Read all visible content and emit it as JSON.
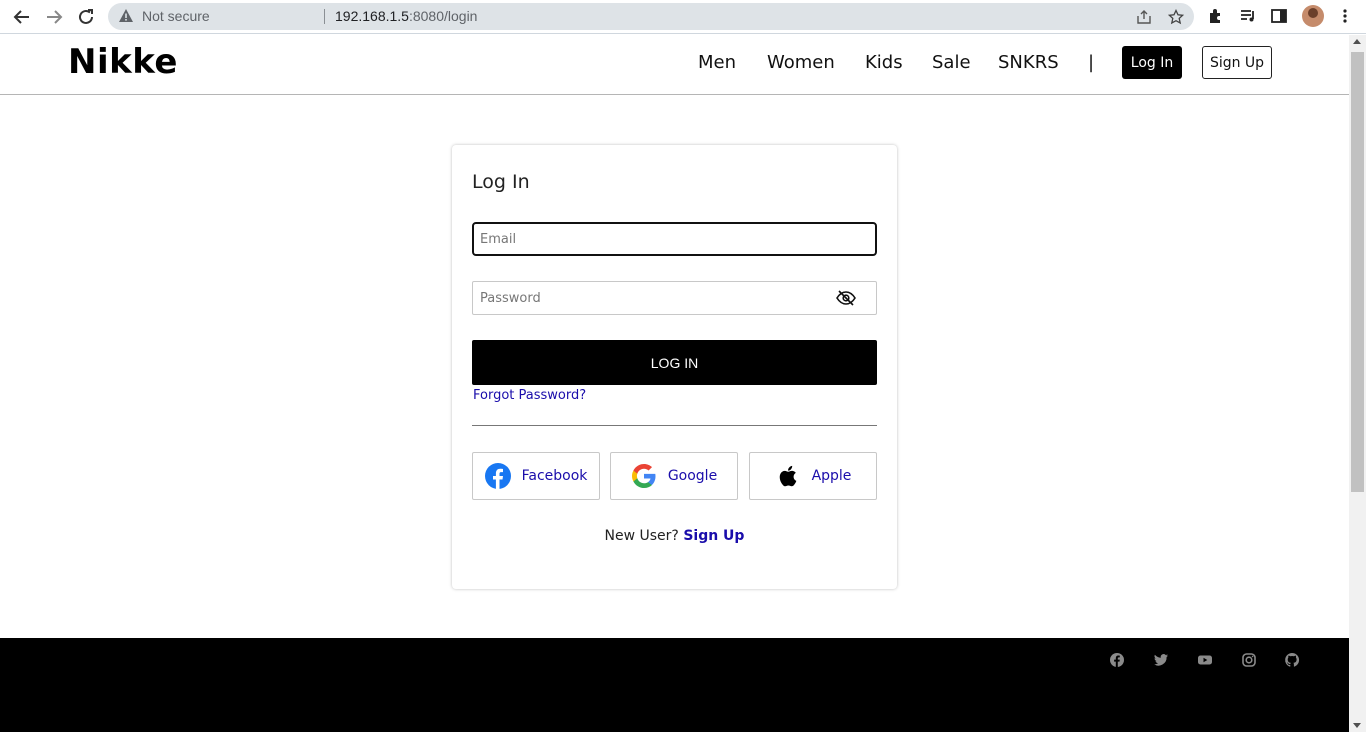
{
  "browser": {
    "security_label": "Not secure",
    "url_host": "192.168.1.5",
    "url_rest": ":8080/login"
  },
  "site": {
    "logo": "Nikke",
    "nav": [
      "Men",
      "Women",
      "Kids",
      "Sale",
      "SNKRS"
    ],
    "nav_separator": "|",
    "login_label": "Log In",
    "signup_label": "Sign Up"
  },
  "login_form": {
    "title": "Log In",
    "email_placeholder": "Email",
    "password_placeholder": "Password",
    "submit_label": "LOG IN",
    "forgot_label": "Forgot Password?",
    "social": [
      {
        "label": "Facebook",
        "icon": "facebook-icon"
      },
      {
        "label": "Google",
        "icon": "google-icon"
      },
      {
        "label": "Apple",
        "icon": "apple-icon"
      }
    ],
    "new_user_text": "New User?",
    "new_user_link": "Sign Up"
  },
  "footer": {
    "icons": [
      "facebook-icon",
      "twitter-icon",
      "youtube-icon",
      "instagram-icon",
      "github-icon"
    ]
  },
  "colors": {
    "link": "#1a0dab",
    "primary": "#000000",
    "omnibox": "#dee3e7"
  }
}
